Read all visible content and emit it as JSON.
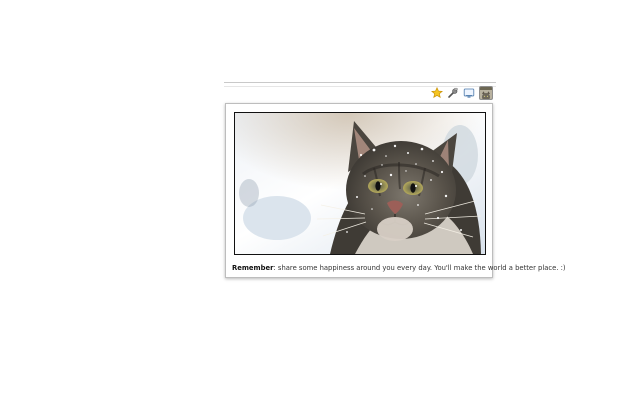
{
  "toolbar": {
    "icons": [
      "star-icon",
      "tool-icon",
      "screen-icon",
      "extension-cat-icon"
    ],
    "colors": {
      "star": "#f5c522",
      "active_icon_border": "#8f8f8f"
    }
  },
  "popup": {
    "image_subject": "cat-photo",
    "caption_bold": "Remember",
    "caption_text": ": share some happiness around you every day. You'll make the world a better place. :)"
  }
}
